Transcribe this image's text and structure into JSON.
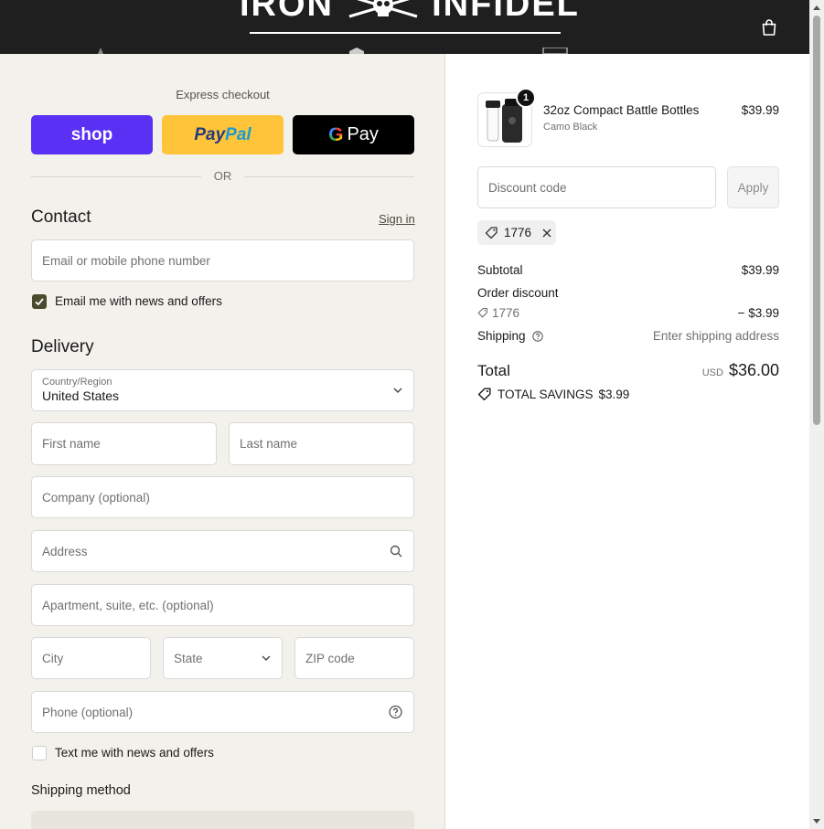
{
  "header": {
    "brand_left": "IRON",
    "brand_right": "INFIDEL",
    "cart_icon": "shopping-bag-icon"
  },
  "express": {
    "label": "Express checkout",
    "shop_label": "shop",
    "paypal_label_1": "Pay",
    "paypal_label_2": "Pal",
    "gpay_g": "G",
    "gpay_label": "Pay",
    "or_label": "OR"
  },
  "contact": {
    "title": "Contact",
    "sign_in": "Sign in",
    "email_placeholder": "Email or mobile phone number",
    "news_label": "Email me with news and offers",
    "news_checked": true
  },
  "delivery": {
    "title": "Delivery",
    "country_label": "Country/Region",
    "country_value": "United States",
    "first_name": "First name",
    "last_name": "Last name",
    "company": "Company (optional)",
    "address": "Address",
    "apartment": "Apartment, suite, etc. (optional)",
    "city": "City",
    "state": "State",
    "zip": "ZIP code",
    "phone": "Phone (optional)",
    "text_label": "Text me with news and offers",
    "text_checked": false
  },
  "shipping_method": {
    "title": "Shipping method"
  },
  "order": {
    "product_name": "32oz Compact Battle Bottles",
    "variant": "Camo Black",
    "price": "$39.99",
    "quantity": "1",
    "discount_placeholder": "Discount code",
    "apply_label": "Apply",
    "applied_code": "1776",
    "subtotal_label": "Subtotal",
    "subtotal_value": "$39.99",
    "order_discount_label": "Order discount",
    "discount_code": "1776",
    "discount_value": "− $3.99",
    "shipping_label": "Shipping",
    "shipping_value": "Enter shipping address",
    "total_label": "Total",
    "currency": "USD",
    "total_value": "$36.00",
    "savings_label": "TOTAL SAVINGS",
    "savings_value": "$3.99"
  },
  "colors": {
    "header_bg": "#1f1f1f",
    "left_bg": "#f3f1eb",
    "shop": "#5a31f4",
    "paypal": "#ffc439",
    "checkbox": "#4a4a2e"
  }
}
